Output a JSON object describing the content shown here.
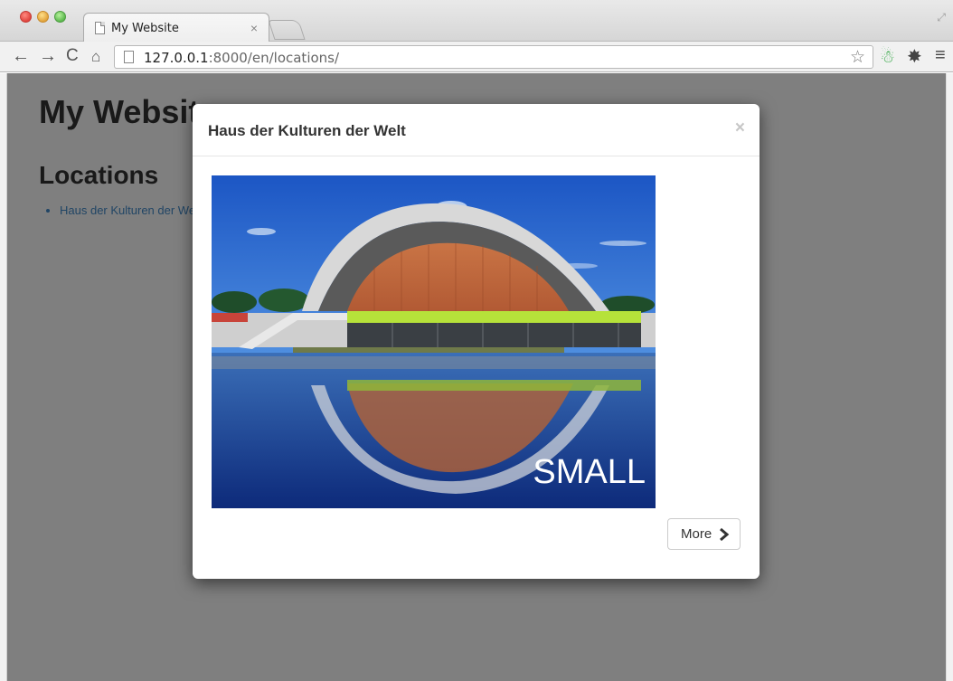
{
  "browser": {
    "tab_title": "My Website",
    "tab_close": "×",
    "url_host": "127.0.0.1",
    "url_rest": ":8000/en/locations/",
    "icons": {
      "back": "←",
      "forward": "→",
      "reload": "C",
      "home": "⌂",
      "bookmark": "☆",
      "extension": "☃",
      "settings": "✸",
      "menu": "≡",
      "restore": "⤢"
    }
  },
  "page": {
    "heading": "My Website",
    "subheading": "Locations",
    "locations": [
      "Haus der Kulturen der Welt"
    ]
  },
  "modal": {
    "title": "Haus der Kulturen der Welt",
    "close": "×",
    "image_label": "SMALL",
    "more_label": "More"
  }
}
